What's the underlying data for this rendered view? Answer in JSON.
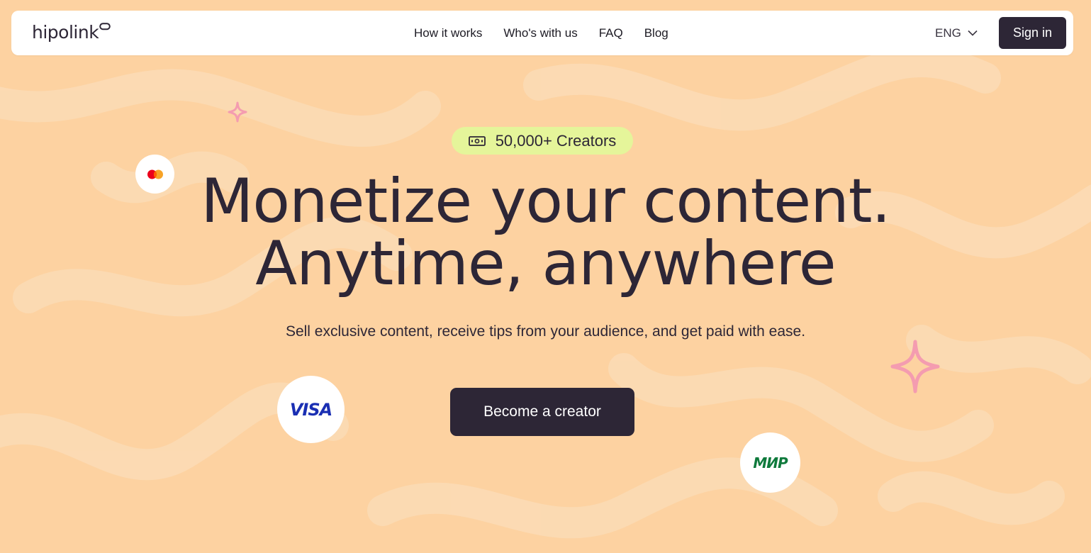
{
  "header": {
    "logo_text": "hipolink",
    "nav": [
      {
        "label": "How it works"
      },
      {
        "label": "Who's with us"
      },
      {
        "label": "FAQ"
      },
      {
        "label": "Blog"
      }
    ],
    "language": "ENG",
    "sign_in_label": "Sign in"
  },
  "hero": {
    "badge_text": "50,000+ Creators",
    "headline_line1": "Monetize your content.",
    "headline_line2": "Anytime, anywhere",
    "subtitle": "Sell exclusive content, receive tips from your audience, and get paid with ease.",
    "cta_label": "Become a creator"
  },
  "payment_logos": {
    "visa": "VISA",
    "mir": "МИР"
  },
  "colors": {
    "background": "#fdd2a1",
    "wave": "#fbdbb4",
    "dark": "#2d2636",
    "badge": "#e5f59a",
    "sparkle": "#f49cb0",
    "visa": "#1a2fb3",
    "mir": "#0f7a3c"
  },
  "icons": [
    "chevron-down-icon",
    "banknote-icon",
    "mastercard-icon",
    "sparkle-icon"
  ]
}
